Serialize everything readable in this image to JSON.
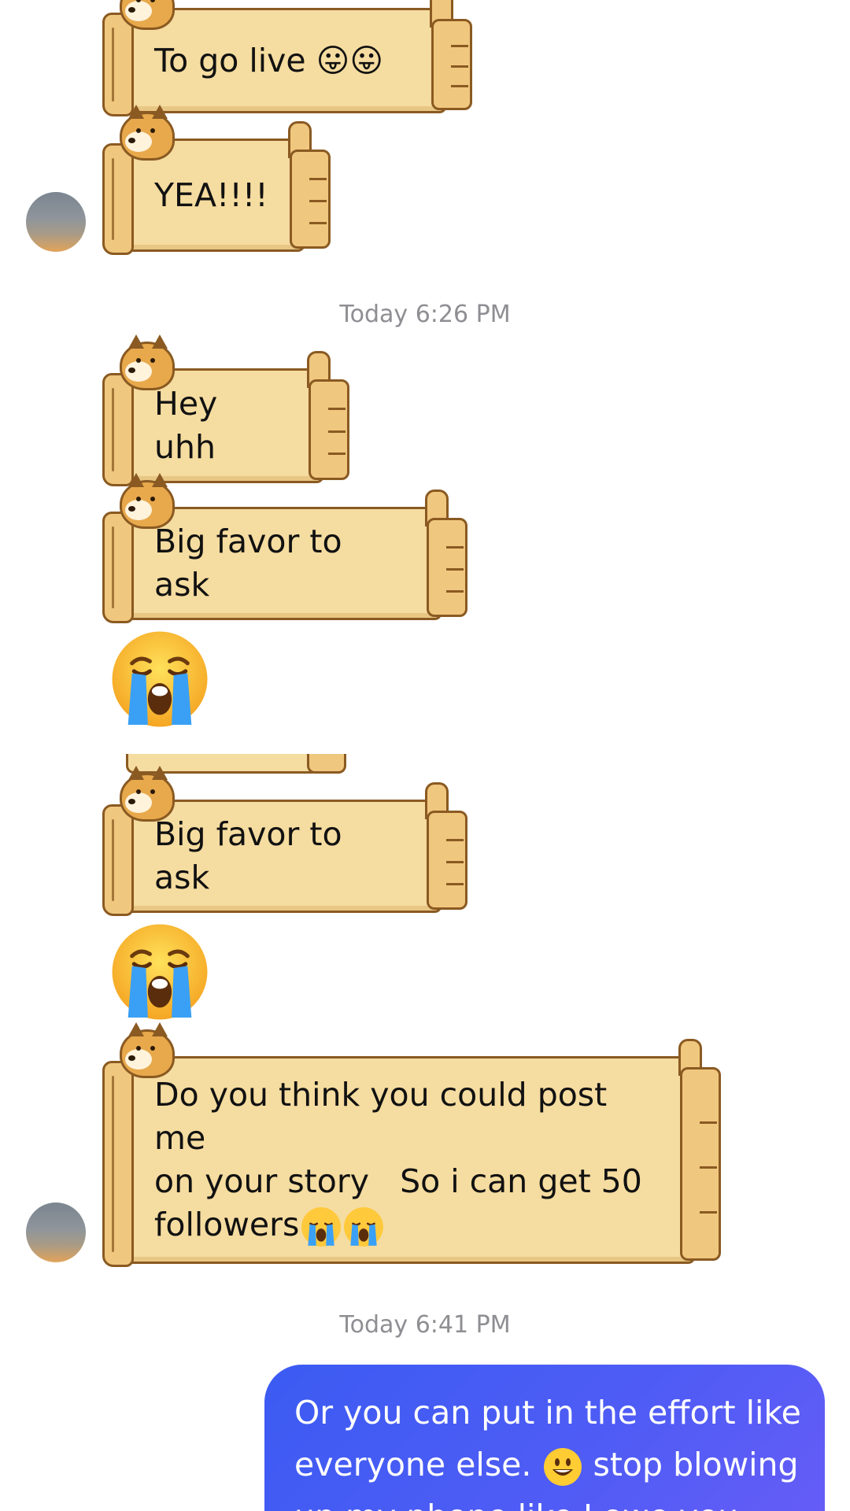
{
  "messages": {
    "incoming": [
      {
        "text": "To go live 😛😛"
      },
      {
        "text": "YEA!!!!"
      },
      {
        "text": "Hey uhh"
      },
      {
        "text": "Big favor to ask"
      },
      {
        "text": "Big favor to ask"
      },
      {
        "text": "Do you think you could post me\non your story   So i can get 50\nfollowers"
      }
    ],
    "big_emoji": "😭",
    "inline_emoji": "😭"
  },
  "timestamps": {
    "first": "Today 6:26 PM",
    "second": "Today 6:41 PM"
  },
  "outgoing": {
    "line1": "Or you can put in the effort like",
    "line2_a": "everyone else.",
    "line2_b": "stop blowing",
    "line3": "up my phone like I owe you"
  },
  "icons": {
    "avatar": "avatar",
    "doge": "doge-sticker",
    "smiley": "grinning-face-icon",
    "crying": "crying-face-icon"
  }
}
